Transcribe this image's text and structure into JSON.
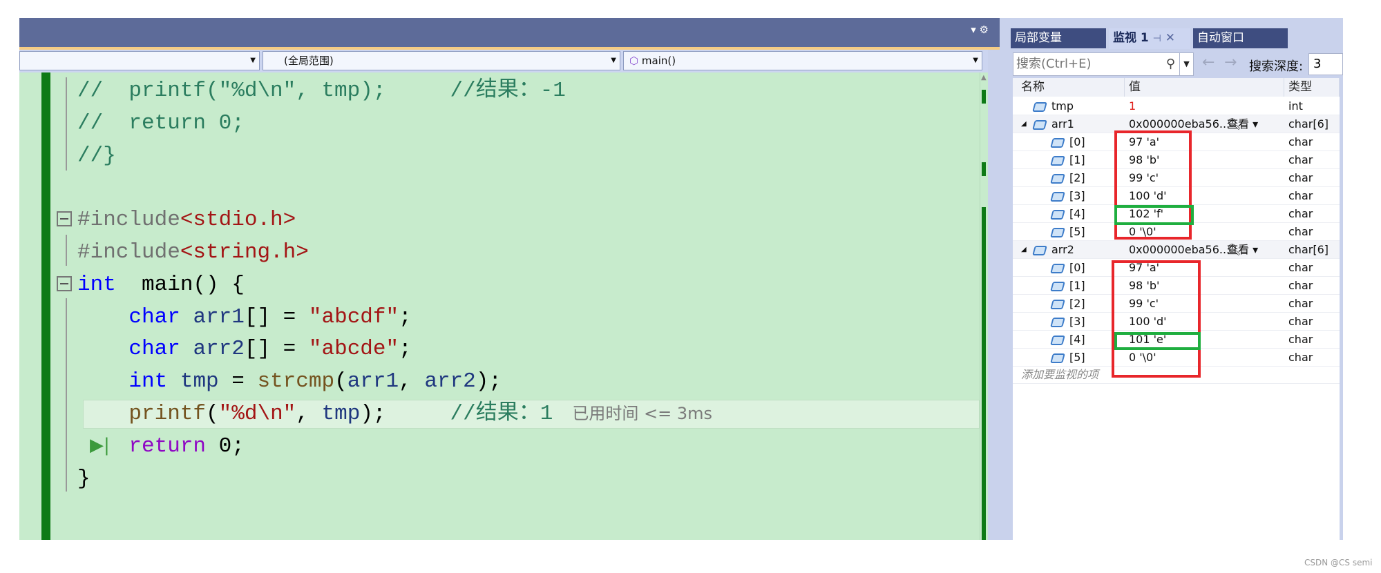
{
  "editor": {
    "dropdowns": [
      "",
      "(全局范围)",
      "main()"
    ],
    "lines": [
      [
        [
          "cm",
          "//  printf(\"%d\\n\", tmp);     //结果：-1"
        ]
      ],
      [
        [
          "cm",
          "//  return 0;"
        ]
      ],
      [
        [
          "cm",
          "//}"
        ]
      ],
      [],
      [
        [
          "pp",
          "#include"
        ],
        [
          "inc",
          "<stdio.h>"
        ]
      ],
      [
        [
          "pp",
          "#include"
        ],
        [
          "inc",
          "<string.h>"
        ]
      ],
      [
        [
          "kw",
          "int"
        ],
        [
          "",
          "  main() {"
        ]
      ],
      [
        [
          "",
          "    "
        ],
        [
          "kw",
          "char"
        ],
        [
          "",
          " "
        ],
        [
          "var",
          "arr1"
        ],
        [
          "",
          "[] = "
        ],
        [
          "str",
          "\"abcdf\""
        ],
        [
          "",
          ";"
        ]
      ],
      [
        [
          "",
          "    "
        ],
        [
          "kw",
          "char"
        ],
        [
          "",
          " "
        ],
        [
          "var",
          "arr2"
        ],
        [
          "",
          "[] = "
        ],
        [
          "str",
          "\"abcde\""
        ],
        [
          "",
          ";"
        ]
      ],
      [
        [
          "",
          "    "
        ],
        [
          "kw",
          "int"
        ],
        [
          "",
          " "
        ],
        [
          "var",
          "tmp"
        ],
        [
          "",
          " = "
        ],
        [
          "fn",
          "strcmp"
        ],
        [
          "",
          "("
        ],
        [
          "var",
          "arr1"
        ],
        [
          "",
          ", "
        ],
        [
          "var",
          "arr2"
        ],
        [
          "",
          ");"
        ]
      ],
      [
        [
          "",
          "    "
        ],
        [
          "fn",
          "printf"
        ],
        [
          "",
          "("
        ],
        [
          "str",
          "\"%d\\n\""
        ],
        [
          "",
          ", "
        ],
        [
          "var",
          "tmp"
        ],
        [
          "",
          ");     "
        ],
        [
          "cm",
          "//结果：1"
        ]
      ],
      [
        [
          "",
          "    "
        ],
        [
          "ret",
          "return"
        ],
        [
          "",
          " 0;"
        ]
      ],
      [
        [
          "",
          "}"
        ]
      ]
    ],
    "inline_hint": "已用时间 <= 3ms"
  },
  "watch": {
    "tabs": [
      "局部变量",
      "监视 1",
      "自动窗口"
    ],
    "search_placeholder": "搜索(Ctrl+E)",
    "depth_label": "搜索深度:",
    "depth_value": "3",
    "columns": [
      "名称",
      "值",
      "类型"
    ],
    "rows": [
      {
        "name": "tmp",
        "value": "1",
        "type": "int",
        "level": 0,
        "changed": true
      },
      {
        "name": "arr1",
        "value": "0x000000eba56...",
        "type": "char[6]",
        "level": 0,
        "expanded": true,
        "view": "查看"
      },
      {
        "name": "[0]",
        "value": "97 'a'",
        "type": "char",
        "level": 1
      },
      {
        "name": "[1]",
        "value": "98 'b'",
        "type": "char",
        "level": 1
      },
      {
        "name": "[2]",
        "value": "99 'c'",
        "type": "char",
        "level": 1
      },
      {
        "name": "[3]",
        "value": "100 'd'",
        "type": "char",
        "level": 1
      },
      {
        "name": "[4]",
        "value": "102 'f'",
        "type": "char",
        "level": 1
      },
      {
        "name": "[5]",
        "value": "0 '\\0'",
        "type": "char",
        "level": 1
      },
      {
        "name": "arr2",
        "value": "0x000000eba56...",
        "type": "char[6]",
        "level": 0,
        "expanded": true,
        "view": "查看"
      },
      {
        "name": "[0]",
        "value": "97 'a'",
        "type": "char",
        "level": 1
      },
      {
        "name": "[1]",
        "value": "98 'b'",
        "type": "char",
        "level": 1
      },
      {
        "name": "[2]",
        "value": "99 'c'",
        "type": "char",
        "level": 1
      },
      {
        "name": "[3]",
        "value": "100 'd'",
        "type": "char",
        "level": 1
      },
      {
        "name": "[4]",
        "value": "101 'e'",
        "type": "char",
        "level": 1
      },
      {
        "name": "[5]",
        "value": "0 '\\0'",
        "type": "char",
        "level": 1
      }
    ],
    "add_item_placeholder": "添加要监视的项"
  },
  "annotation_colors": {
    "red": "#e8262b",
    "green": "#1fae3f"
  },
  "watermark": "CSDN @CS semi"
}
